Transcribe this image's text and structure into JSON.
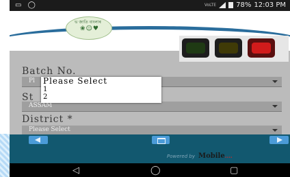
{
  "status_bar": {
    "left_icons": "▭ ◯",
    "network_label": "VoLTE",
    "battery": "78%",
    "time": "12:03 PM"
  },
  "header": {
    "logo_text": "ভ জাতি বাংলাৰ",
    "logo_icons": "❀☺♥"
  },
  "form": {
    "batch_label": "Batch No.",
    "batch_value": "Pl",
    "state_label": "St",
    "state_value": "ASSAM",
    "district_label": "District *",
    "district_value": "Please Select"
  },
  "dropdown": {
    "options": [
      "Please Select",
      "1",
      "2"
    ]
  },
  "footer": {
    "powered_text": "Powered by",
    "brand_text": "Mobile",
    "brand_accent": "...."
  },
  "softkeys": {
    "back": "◁",
    "home": "◯",
    "recent": "▢"
  },
  "colors": {
    "footer": "#12586f",
    "button": "#4b9bd8",
    "overlay": "#bbbbbb"
  }
}
